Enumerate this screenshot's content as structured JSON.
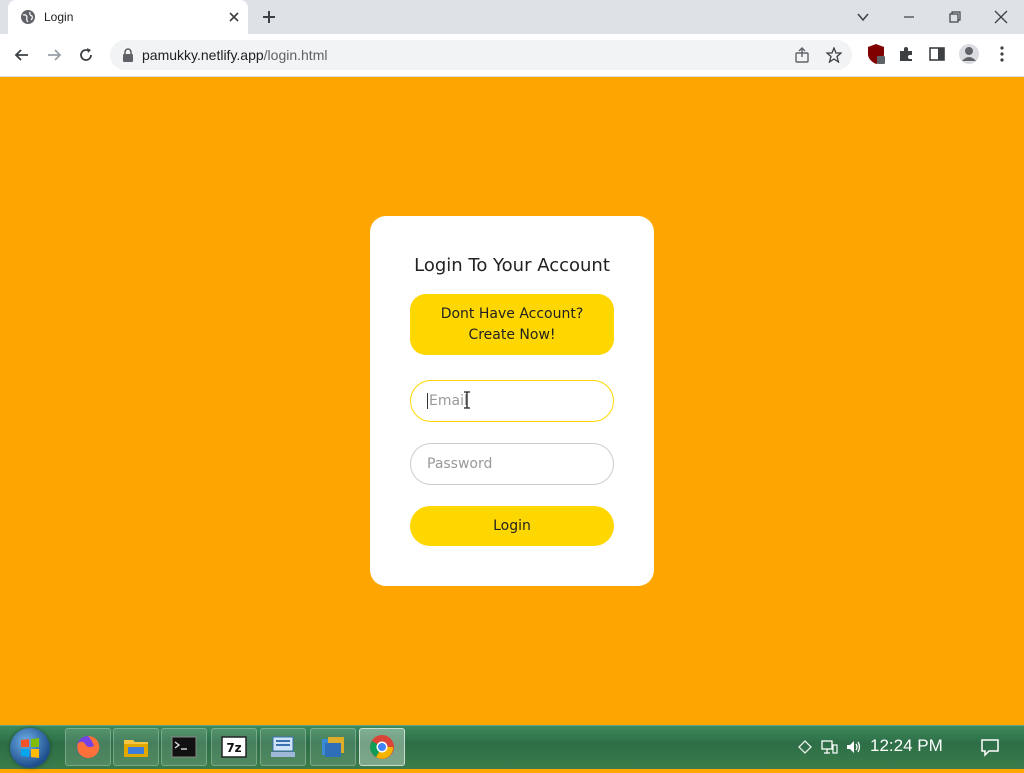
{
  "browser": {
    "tab_title": "Login",
    "url_host": "pamukky.netlify.app",
    "url_path": "/login.html"
  },
  "login_card": {
    "title": "Login To Your Account",
    "signup_line1": "Dont Have Account?",
    "signup_line2": "Create Now!",
    "email_placeholder": "Email",
    "password_placeholder": "Password",
    "login_label": "Login"
  },
  "colors": {
    "page_background": "#ffa500",
    "accent": "#ffd700",
    "card": "#ffffff"
  },
  "taskbar": {
    "clock": "12:24 PM",
    "apps": [
      "firefox-icon",
      "file-explorer-icon",
      "terminal-icon",
      "7zip-icon",
      "remote-desktop-icon",
      "folder-icon",
      "chrome-icon"
    ]
  }
}
